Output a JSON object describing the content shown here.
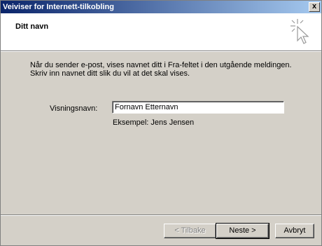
{
  "window": {
    "title": "Veiviser for Internett-tilkobling",
    "close_label": "x"
  },
  "header": {
    "title": "Ditt navn",
    "icon": "wizard-sparkle-cursor-icon"
  },
  "content": {
    "intro": "Når du sender e-post, vises navnet ditt i Fra-feltet i den utgående meldingen. Skriv inn navnet ditt slik du vil at det skal vises.",
    "display_name_label": "Visningsnavn:",
    "display_name_value": "Fornavn Etternavn",
    "example": "Eksempel: Jens Jensen"
  },
  "buttons": {
    "back": "< Tilbake",
    "next": "Neste >",
    "cancel": "Avbryt"
  }
}
